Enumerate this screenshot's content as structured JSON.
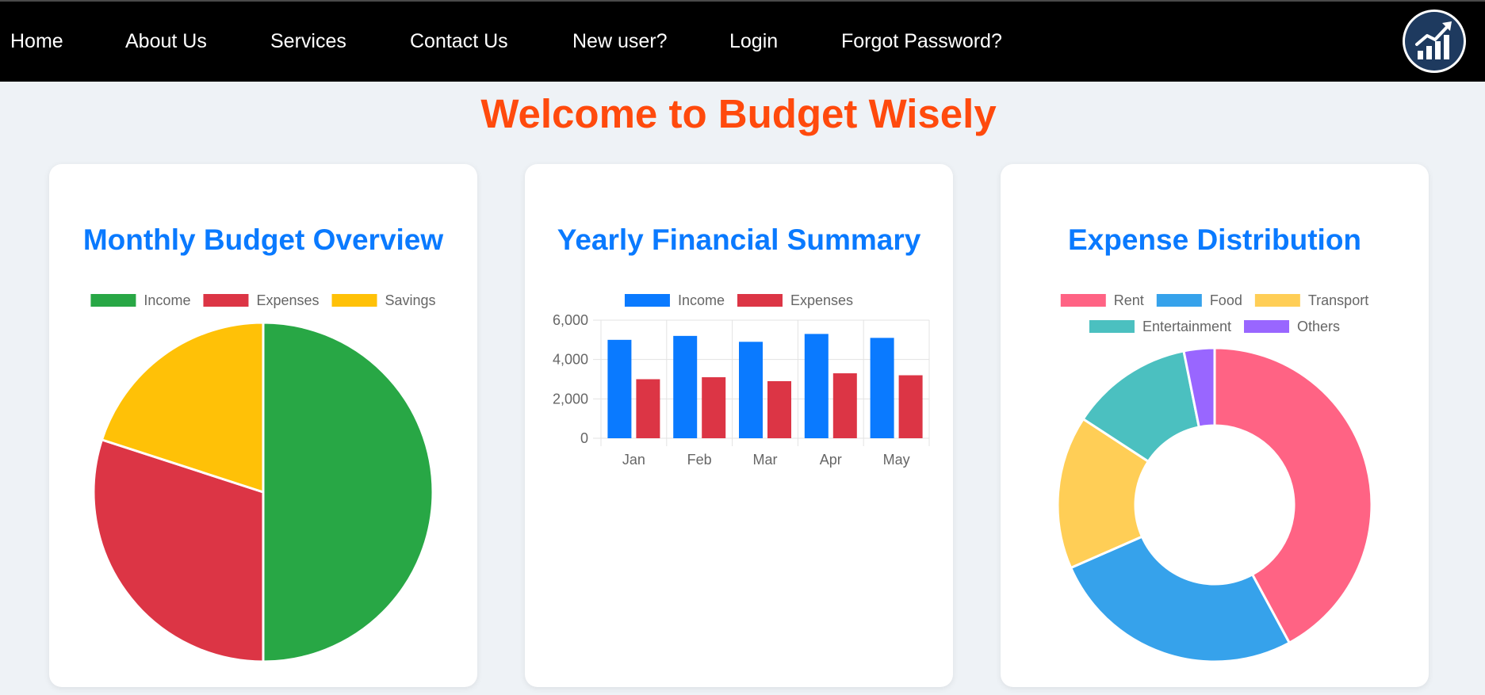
{
  "nav": {
    "items": [
      {
        "label": "Home"
      },
      {
        "label": "About Us"
      },
      {
        "label": "Services"
      },
      {
        "label": "Contact Us"
      },
      {
        "label": "New user?"
      },
      {
        "label": "Login"
      },
      {
        "label": "Forgot Password?"
      }
    ],
    "logo_icon": "growth-chart-icon",
    "logo_color": "#1e3a5f"
  },
  "page": {
    "welcome": "Welcome to Budget Wisely"
  },
  "colors": {
    "accent_title": "#ff4a0d",
    "card_title": "#0a7aff",
    "nav_bg": "#000000",
    "page_bg": "#eef2f6"
  },
  "chart_data": [
    {
      "type": "pie",
      "title": "Monthly Budget Overview",
      "labels": [
        "Income",
        "Expenses",
        "Savings"
      ],
      "values": [
        50,
        30,
        20
      ],
      "colors": [
        "#28a745",
        "#dc3545",
        "#ffc107"
      ],
      "legend": "top"
    },
    {
      "type": "bar",
      "title": "Yearly Financial Summary",
      "categories": [
        "Jan",
        "Feb",
        "Mar",
        "Apr",
        "May"
      ],
      "series": [
        {
          "name": "Income",
          "color": "#0a7aff",
          "values": [
            5000,
            5200,
            4900,
            5300,
            5100
          ]
        },
        {
          "name": "Expenses",
          "color": "#dc3545",
          "values": [
            3000,
            3100,
            2900,
            3300,
            3200
          ]
        }
      ],
      "ylim": [
        0,
        6000
      ],
      "yticks": [
        "6,000",
        "4,000",
        "2,000",
        "0"
      ],
      "grid": true,
      "legend": "top"
    },
    {
      "type": "doughnut",
      "title": "Expense Distribution",
      "labels": [
        "Rent",
        "Food",
        "Transport",
        "Entertainment",
        "Others"
      ],
      "values": [
        40,
        25,
        15,
        12,
        3
      ],
      "colors": [
        "#ff6384",
        "#36a2eb",
        "#ffce56",
        "#4bc0c0",
        "#9966ff"
      ],
      "legend": "top"
    }
  ]
}
